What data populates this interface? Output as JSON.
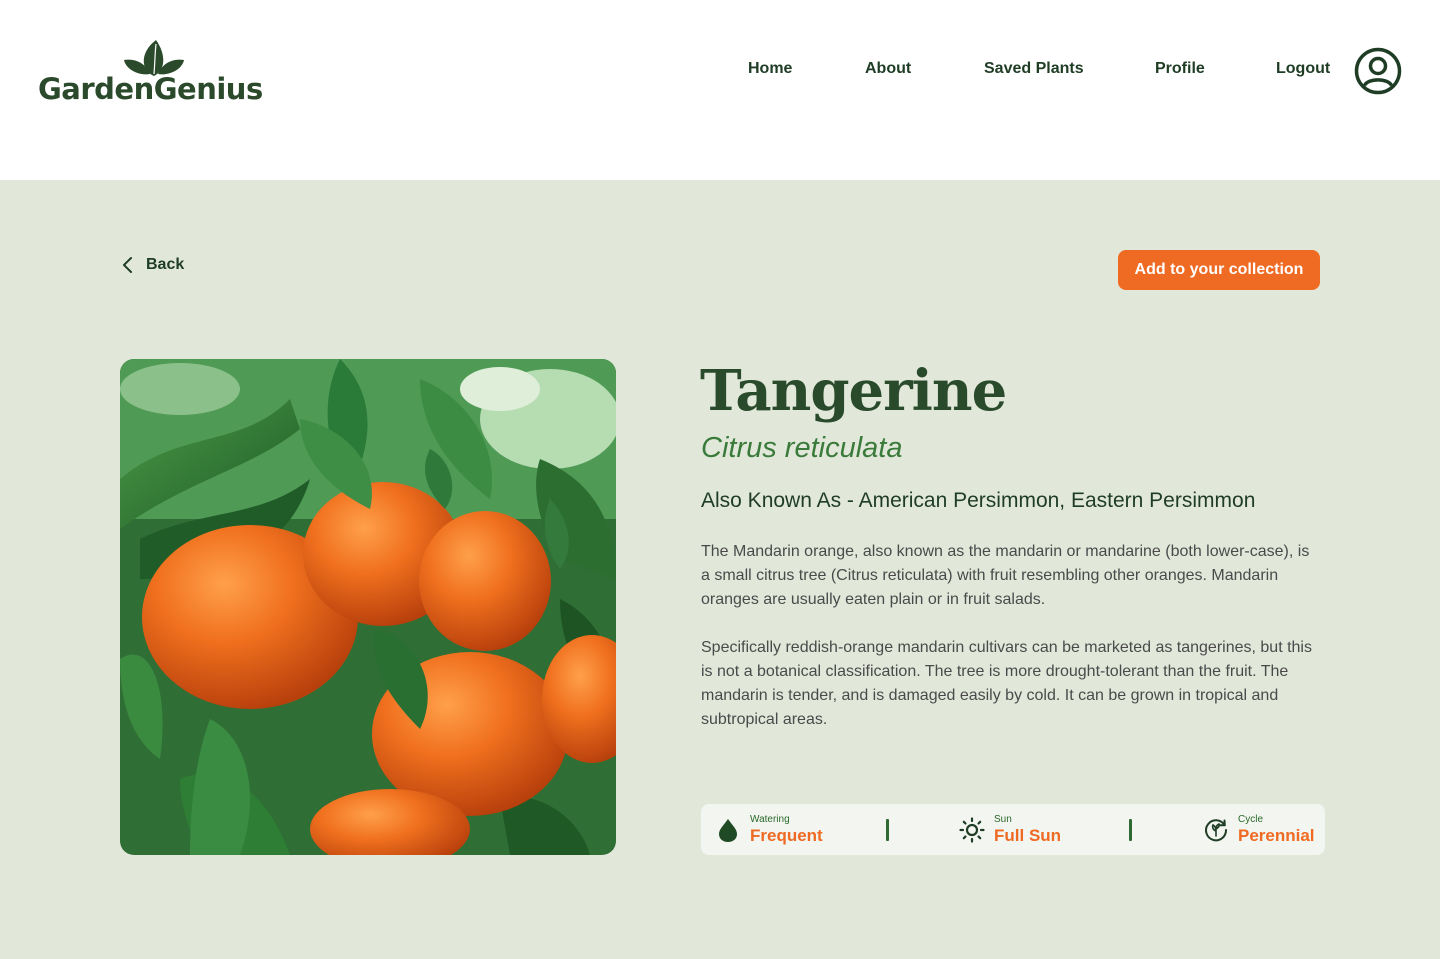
{
  "brand": {
    "name": "GardenGenius"
  },
  "nav": {
    "home": "Home",
    "about": "About",
    "saved_plants": "Saved Plants",
    "profile": "Profile",
    "logout": "Logout"
  },
  "actions": {
    "back": "Back",
    "add_to_collection": "Add to your collection"
  },
  "plant": {
    "common_name": "Tangerine",
    "scientific_name": "Citrus reticulata",
    "also_known_as": "Also Known As - American Persimmon, Eastern Persimmon",
    "description": [
      "The Mandarin orange, also known as the mandarin or mandarine (both lower-case), is a small citrus tree (Citrus reticulata) with fruit resembling other oranges. Mandarin oranges are usually eaten plain or in fruit salads.",
      "Specifically reddish-orange mandarin cultivars can be marketed as tangerines, but this is not a botanical classification. The tree is more drought-tolerant than the fruit. The mandarin is tender, and is damaged easily by cold. It can be grown in tropical and subtropical areas."
    ],
    "stats": {
      "watering": {
        "label": "Watering",
        "value": "Frequent",
        "icon": "water-drop-icon"
      },
      "sun": {
        "label": "Sun",
        "value": "Full Sun",
        "icon": "sun-icon"
      },
      "cycle": {
        "label": "Cycle",
        "value": "Perennial",
        "icon": "cycle-icon"
      }
    }
  },
  "colors": {
    "accent": "#ef6a22",
    "brand_green": "#2b4a2c",
    "background": "#e1e8da"
  }
}
